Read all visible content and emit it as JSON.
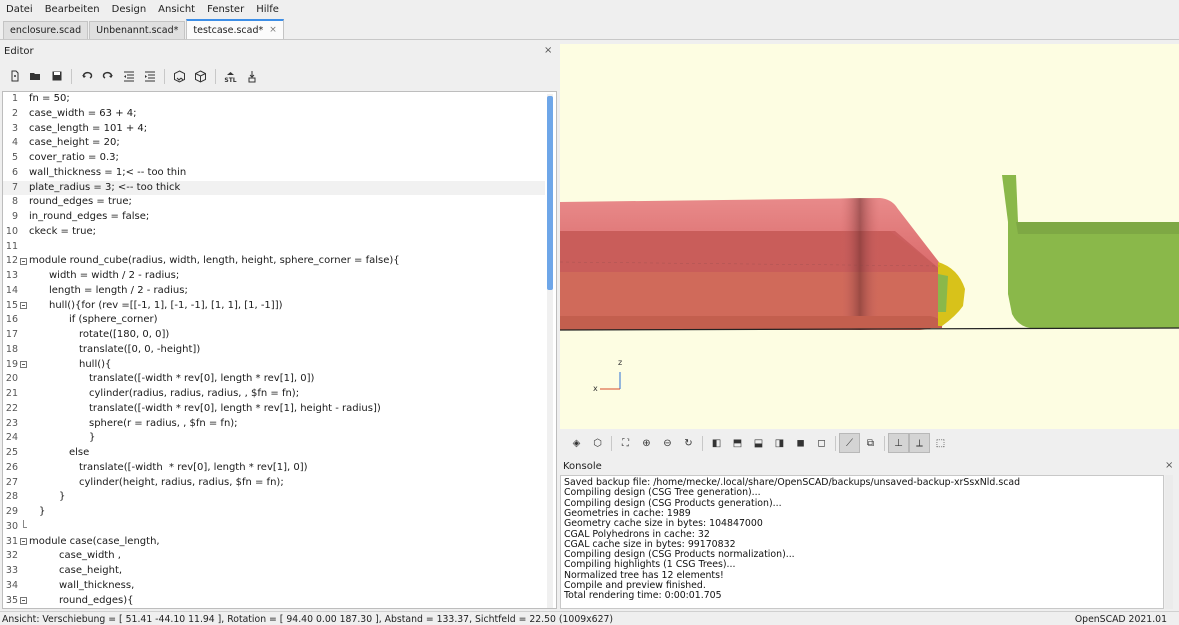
{
  "menu": [
    "Datei",
    "Bearbeiten",
    "Design",
    "Ansicht",
    "Fenster",
    "Hilfe"
  ],
  "tabs": [
    {
      "label": "enclosure.scad",
      "active": false
    },
    {
      "label": "Unbenannt.scad*",
      "active": false
    },
    {
      "label": "testcase.scad*",
      "active": true,
      "close": "×"
    }
  ],
  "editor": {
    "title": "Editor",
    "close": "×",
    "toolbar_icons": [
      "new-file-icon",
      "open-file-icon",
      "save-file-icon",
      "undo-icon",
      "redo-icon",
      "unindent-icon",
      "indent-icon",
      "preview-icon",
      "render-icon",
      "export-stl-icon",
      "send-to-printer-icon"
    ],
    "stl_label": "STL",
    "highlighted_line": 7,
    "lines": [
      {
        "n": "1",
        "indent": 0,
        "text": "fn = 50;"
      },
      {
        "n": "2",
        "indent": 0,
        "text": "case_width = 63 + 4;"
      },
      {
        "n": "3",
        "indent": 0,
        "text": "case_length = 101 + 4;"
      },
      {
        "n": "4",
        "indent": 0,
        "text": "case_height = 20;"
      },
      {
        "n": "5",
        "indent": 0,
        "text": "cover_ratio = 0.3;"
      },
      {
        "n": "6",
        "indent": 0,
        "text": "wall_thickness = 1;< -- too thin"
      },
      {
        "n": "7",
        "indent": 0,
        "text": "plate_radius = 3; <-- too thick"
      },
      {
        "n": "8",
        "indent": 0,
        "text": "round_edges = true;"
      },
      {
        "n": "9",
        "indent": 0,
        "text": "in_round_edges = false;"
      },
      {
        "n": "10",
        "indent": 0,
        "text": "ckeck = true;"
      },
      {
        "n": "11",
        "indent": 0,
        "text": ""
      },
      {
        "n": "12",
        "indent": 0,
        "fold": "start",
        "text": "module round_cube(radius, width, length, height, sphere_corner = false){"
      },
      {
        "n": "13",
        "indent": 2,
        "text": "width = width / 2 - radius;"
      },
      {
        "n": "14",
        "indent": 2,
        "text": "length = length / 2 - radius;"
      },
      {
        "n": "15",
        "indent": 2,
        "fold": "start",
        "text": "hull(){for (rev =[[-1, 1], [-1, -1], [1, 1], [1, -1]])"
      },
      {
        "n": "16",
        "indent": 4,
        "text": "if (sphere_corner)"
      },
      {
        "n": "17",
        "indent": 5,
        "text": "rotate([180, 0, 0])"
      },
      {
        "n": "18",
        "indent": 5,
        "text": "translate([0, 0, -height])"
      },
      {
        "n": "19",
        "indent": 5,
        "fold": "start",
        "text": "hull(){"
      },
      {
        "n": "20",
        "indent": 6,
        "text": "translate([-width * rev[0], length * rev[1], 0])"
      },
      {
        "n": "21",
        "indent": 6,
        "text": "cylinder(radius, radius, radius, , $fn = fn);"
      },
      {
        "n": "22",
        "indent": 6,
        "text": "translate([-width * rev[0], length * rev[1], height - radius])"
      },
      {
        "n": "23",
        "indent": 6,
        "text": "sphere(r = radius, , $fn = fn);"
      },
      {
        "n": "24",
        "indent": 6,
        "text": "}"
      },
      {
        "n": "25",
        "indent": 4,
        "text": "else"
      },
      {
        "n": "26",
        "indent": 5,
        "text": "translate([-width  * rev[0], length * rev[1], 0])"
      },
      {
        "n": "27",
        "indent": 5,
        "text": "cylinder(height, radius, radius, $fn = fn);"
      },
      {
        "n": "28",
        "indent": 3,
        "text": "}"
      },
      {
        "n": "29",
        "indent": 1,
        "text": "}"
      },
      {
        "n": "30",
        "indent": 0,
        "fold": "end",
        "text": ""
      },
      {
        "n": "31",
        "indent": 0,
        "fold": "start",
        "text": "module case(case_length,"
      },
      {
        "n": "32",
        "indent": 3,
        "text": "case_width ,"
      },
      {
        "n": "33",
        "indent": 3,
        "text": "case_height,"
      },
      {
        "n": "34",
        "indent": 3,
        "text": "wall_thickness,"
      },
      {
        "n": "35",
        "indent": 3,
        "fold": "start",
        "text": "round_edges){"
      }
    ]
  },
  "viewport": {
    "background": "#fdfde2",
    "axis_label_z": "z",
    "axis_label_x": "x",
    "colors": {
      "red": "#d76b6b",
      "yellow": "#d8c21a",
      "green": "#8ab84a"
    }
  },
  "view_toolbar_icons": [
    "preview-icon",
    "render-icon",
    "view-all-icon",
    "zoom-in-icon",
    "zoom-out-icon",
    "reset-view-icon",
    "view-right-icon",
    "view-top-icon",
    "view-bottom-icon",
    "view-left-icon",
    "view-front-icon",
    "view-back-icon",
    "perspective-icon",
    "orthogonal-icon",
    "show-axes-icon",
    "show-scale-icon",
    "show-edges-icon"
  ],
  "console": {
    "title": "Konsole",
    "close": "×",
    "lines": [
      "Saved backup file: /home/mecke/.local/share/OpenSCAD/backups/unsaved-backup-xrSsxNld.scad",
      "Compiling design (CSG Tree generation)...",
      "Compiling design (CSG Products generation)...",
      "Geometries in cache: 1989",
      "Geometry cache size in bytes: 104847000",
      "CGAL Polyhedrons in cache: 32",
      "CGAL cache size in bytes: 99170832",
      "Compiling design (CSG Products normalization)...",
      "Compiling highlights (1 CSG Trees)...",
      "Normalized tree has 12 elements!",
      "Compile and preview finished.",
      "Total rendering time: 0:00:01.705"
    ]
  },
  "status": {
    "left": "Ansicht: Verschiebung = [ 51.41 -44.10 11.94 ], Rotation = [ 94.40 0.00 187.30 ], Abstand = 133.37, Sichtfeld = 22.50 (1009x627)",
    "right": "OpenSCAD 2021.01"
  }
}
